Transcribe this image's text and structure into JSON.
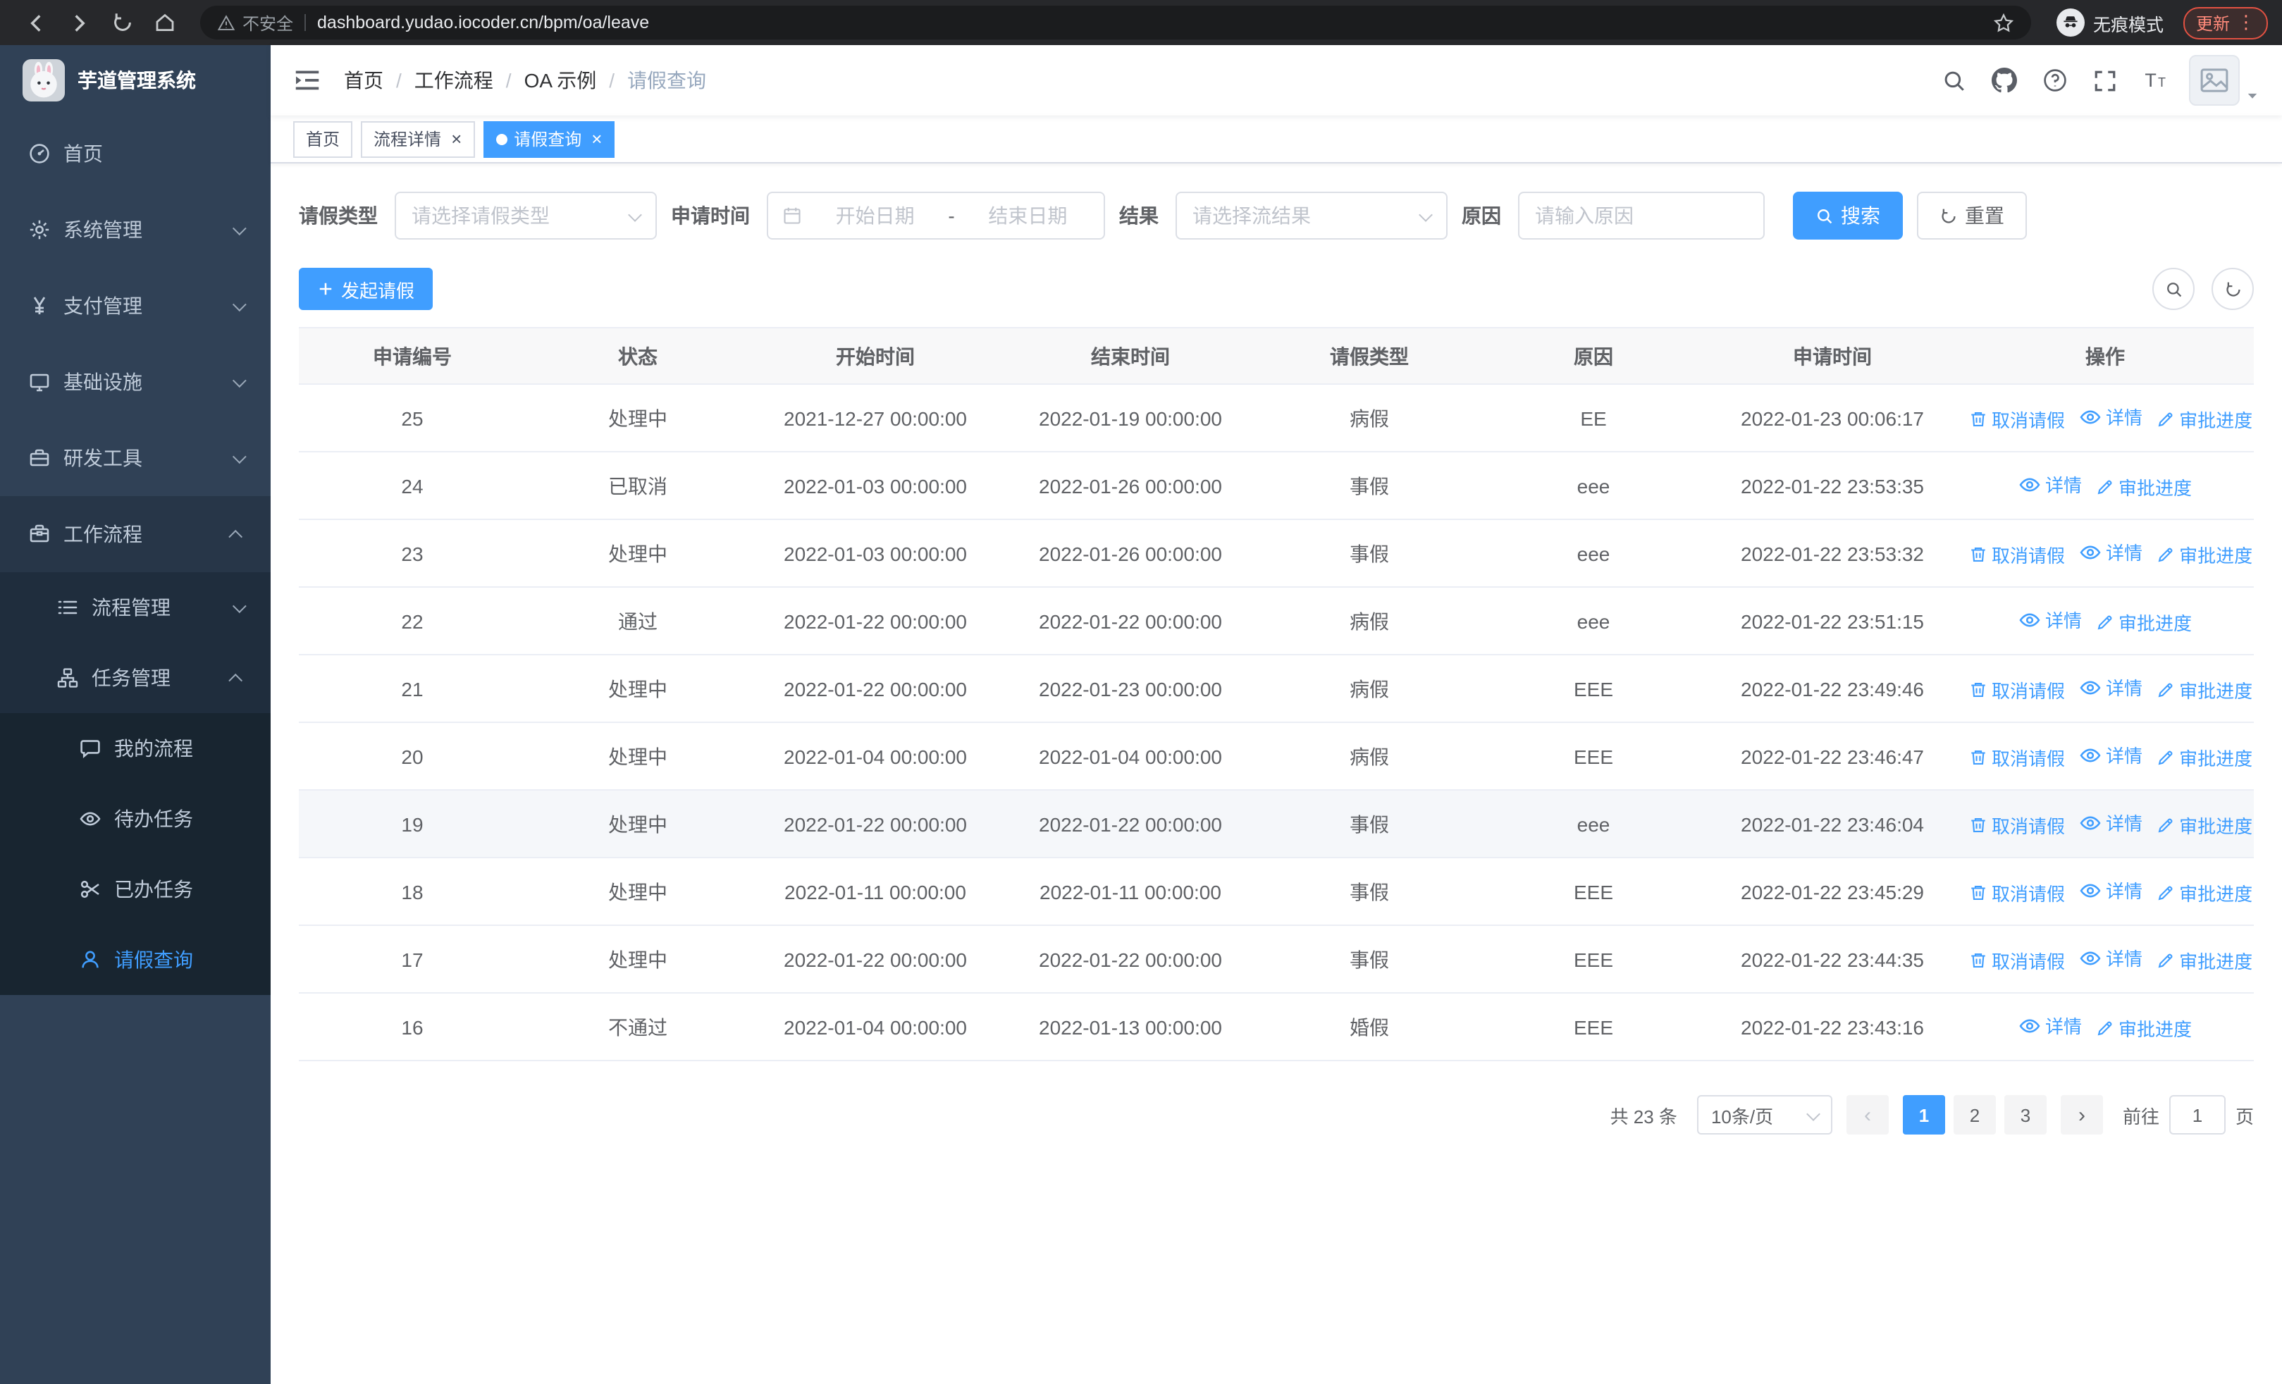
{
  "theme": {
    "primary": "#409EFF",
    "sidebar_bg": "#304156",
    "sidebar_submenu_bg": "#1f2d3d",
    "sidebar_text": "#bfcbd9",
    "link_color": "#409EFF"
  },
  "browser": {
    "security_label": "不安全",
    "url": "dashboard.yudao.iocoder.cn/bpm/oa/leave",
    "incognito_label": "无痕模式",
    "update_label": "更新",
    "nav_icons": [
      "back-icon",
      "forward-icon",
      "reload-icon",
      "home-icon",
      "star-icon",
      "incognito-icon",
      "menu-dots-icon"
    ]
  },
  "sidebar": {
    "logo_title": "芋道管理系统",
    "items": [
      {
        "name": "home",
        "icon": "dashboard-icon",
        "label": "首页",
        "level": 1
      },
      {
        "name": "system-mgmt",
        "icon": "gear-icon",
        "label": "系统管理",
        "level": 1,
        "arrow": "down"
      },
      {
        "name": "payment-mgmt",
        "icon": "yen-icon",
        "label": "支付管理",
        "level": 1,
        "arrow": "down"
      },
      {
        "name": "infrastructure",
        "icon": "monitor-icon",
        "label": "基础设施",
        "level": 1,
        "arrow": "down"
      },
      {
        "name": "dev-tools",
        "icon": "toolbox-icon",
        "label": "研发工具",
        "level": 1,
        "arrow": "down"
      },
      {
        "name": "workflow",
        "icon": "suitcase-icon",
        "label": "工作流程",
        "level": 1,
        "arrow": "up",
        "expanded": true
      },
      {
        "name": "process-mgmt",
        "icon": "list-icon",
        "label": "流程管理",
        "level": 2,
        "arrow": "down"
      },
      {
        "name": "task-mgmt",
        "icon": "org-icon",
        "label": "任务管理",
        "level": 2,
        "arrow": "up",
        "expanded": true
      },
      {
        "name": "my-process",
        "icon": "chat-icon",
        "label": "我的流程",
        "level": 3
      },
      {
        "name": "todo-task",
        "icon": "eye-icon",
        "label": "待办任务",
        "level": 3
      },
      {
        "name": "done-task",
        "icon": "scissors-icon",
        "label": "已办任务",
        "level": 3
      },
      {
        "name": "leave-query",
        "icon": "user-icon",
        "label": "请假查询",
        "level": 3,
        "active": true
      }
    ]
  },
  "navbar": {
    "breadcrumb": [
      "首页",
      "工作流程",
      "OA 示例",
      "请假查询"
    ],
    "right_icons": [
      "search-icon",
      "github-icon",
      "question-icon",
      "fullscreen-icon",
      "font-size-icon",
      "avatar",
      "caret-down-icon"
    ]
  },
  "tags": [
    {
      "label": "首页",
      "active": false,
      "closable": false
    },
    {
      "label": "流程详情",
      "active": false,
      "closable": true
    },
    {
      "label": "请假查询",
      "active": true,
      "closable": true
    }
  ],
  "filters": {
    "leave_type_label": "请假类型",
    "leave_type_placeholder": "请选择请假类型",
    "apply_time_label": "申请时间",
    "start_date_placeholder": "开始日期",
    "range_separator": "-",
    "end_date_placeholder": "结束日期",
    "result_label": "结果",
    "result_placeholder": "请选择流结果",
    "reason_label": "原因",
    "reason_placeholder": "请输入原因",
    "search_button": "搜索",
    "reset_button": "重置"
  },
  "toolbar": {
    "create_button": "发起请假",
    "right_icons": [
      "search-icon",
      "refresh-icon"
    ]
  },
  "table": {
    "columns": [
      "申请编号",
      "状态",
      "开始时间",
      "结束时间",
      "请假类型",
      "原因",
      "申请时间",
      "操作"
    ],
    "action_labels": {
      "cancel": "取消请假",
      "detail": "详情",
      "progress": "审批进度"
    },
    "rows": [
      {
        "id": "25",
        "status": "处理中",
        "start": "2021-12-27 00:00:00",
        "end": "2022-01-19 00:00:00",
        "type": "病假",
        "reason": "EE",
        "applied": "2022-01-23 00:06:17",
        "actions": [
          "cancel",
          "detail",
          "progress"
        ]
      },
      {
        "id": "24",
        "status": "已取消",
        "start": "2022-01-03 00:00:00",
        "end": "2022-01-26 00:00:00",
        "type": "事假",
        "reason": "eee",
        "applied": "2022-01-22 23:53:35",
        "actions": [
          "detail",
          "progress"
        ]
      },
      {
        "id": "23",
        "status": "处理中",
        "start": "2022-01-03 00:00:00",
        "end": "2022-01-26 00:00:00",
        "type": "事假",
        "reason": "eee",
        "applied": "2022-01-22 23:53:32",
        "actions": [
          "cancel",
          "detail",
          "progress"
        ]
      },
      {
        "id": "22",
        "status": "通过",
        "start": "2022-01-22 00:00:00",
        "end": "2022-01-22 00:00:00",
        "type": "病假",
        "reason": "eee",
        "applied": "2022-01-22 23:51:15",
        "actions": [
          "detail",
          "progress"
        ]
      },
      {
        "id": "21",
        "status": "处理中",
        "start": "2022-01-22 00:00:00",
        "end": "2022-01-23 00:00:00",
        "type": "病假",
        "reason": "EEE",
        "applied": "2022-01-22 23:49:46",
        "actions": [
          "cancel",
          "detail",
          "progress"
        ]
      },
      {
        "id": "20",
        "status": "处理中",
        "start": "2022-01-04 00:00:00",
        "end": "2022-01-04 00:00:00",
        "type": "病假",
        "reason": "EEE",
        "applied": "2022-01-22 23:46:47",
        "actions": [
          "cancel",
          "detail",
          "progress"
        ]
      },
      {
        "id": "19",
        "status": "处理中",
        "start": "2022-01-22 00:00:00",
        "end": "2022-01-22 00:00:00",
        "type": "事假",
        "reason": "eee",
        "applied": "2022-01-22 23:46:04",
        "actions": [
          "cancel",
          "detail",
          "progress"
        ],
        "highlighted": true
      },
      {
        "id": "18",
        "status": "处理中",
        "start": "2022-01-11 00:00:00",
        "end": "2022-01-11 00:00:00",
        "type": "事假",
        "reason": "EEE",
        "applied": "2022-01-22 23:45:29",
        "actions": [
          "cancel",
          "detail",
          "progress"
        ]
      },
      {
        "id": "17",
        "status": "处理中",
        "start": "2022-01-22 00:00:00",
        "end": "2022-01-22 00:00:00",
        "type": "事假",
        "reason": "EEE",
        "applied": "2022-01-22 23:44:35",
        "actions": [
          "cancel",
          "detail",
          "progress"
        ]
      },
      {
        "id": "16",
        "status": "不通过",
        "start": "2022-01-04 00:00:00",
        "end": "2022-01-13 00:00:00",
        "type": "婚假",
        "reason": "EEE",
        "applied": "2022-01-22 23:43:16",
        "actions": [
          "detail",
          "progress"
        ]
      }
    ]
  },
  "pagination": {
    "total_text": "共 23 条",
    "page_size": "10条/页",
    "pages": [
      "1",
      "2",
      "3"
    ],
    "active_page": "1",
    "goto_label": "前往",
    "goto_value": "1",
    "goto_suffix": "页"
  }
}
